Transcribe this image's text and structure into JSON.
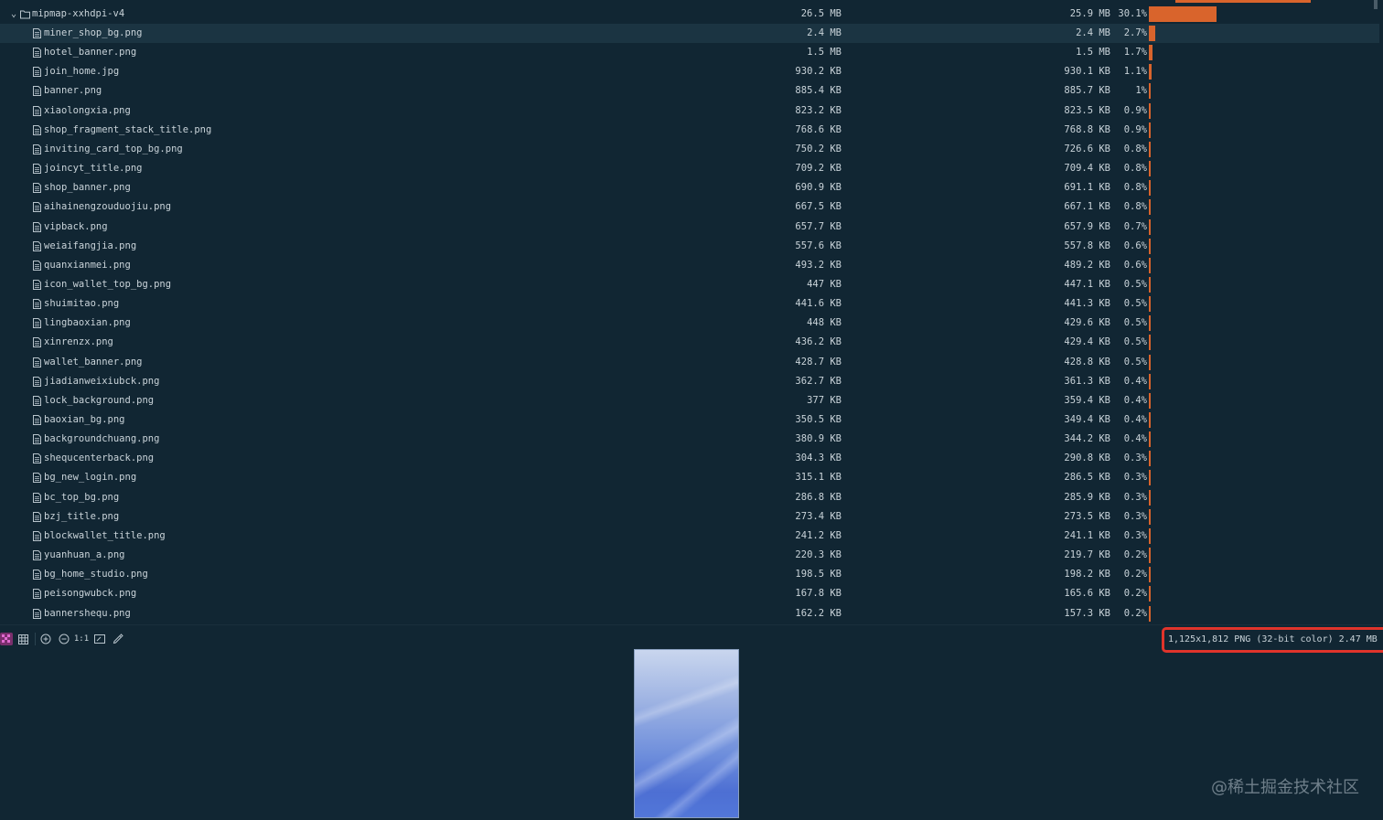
{
  "folder": {
    "name": "mipmap-xxhdpi-v4",
    "size": "26.5 MB",
    "size2": "25.9 MB",
    "percent": "30.1%",
    "bar_fraction": 0.301,
    "expanded": true
  },
  "files": [
    {
      "name": "miner_shop_bg.png",
      "size": "2.4 MB",
      "size2": "2.4 MB",
      "percent": "2.7%",
      "fraction": 0.027,
      "selected": true
    },
    {
      "name": "hotel_banner.png",
      "size": "1.5 MB",
      "size2": "1.5 MB",
      "percent": "1.7%",
      "fraction": 0.017
    },
    {
      "name": "join_home.jpg",
      "size": "930.2 KB",
      "size2": "930.1 KB",
      "percent": "1.1%",
      "fraction": 0.011
    },
    {
      "name": "banner.png",
      "size": "885.4 KB",
      "size2": "885.7 KB",
      "percent": "1%",
      "fraction": 0.01
    },
    {
      "name": "xiaolongxia.png",
      "size": "823.2 KB",
      "size2": "823.5 KB",
      "percent": "0.9%",
      "fraction": 0.009
    },
    {
      "name": "shop_fragment_stack_title.png",
      "size": "768.6 KB",
      "size2": "768.8 KB",
      "percent": "0.9%",
      "fraction": 0.009
    },
    {
      "name": "inviting_card_top_bg.png",
      "size": "750.2 KB",
      "size2": "726.6 KB",
      "percent": "0.8%",
      "fraction": 0.008
    },
    {
      "name": "joincyt_title.png",
      "size": "709.2 KB",
      "size2": "709.4 KB",
      "percent": "0.8%",
      "fraction": 0.008
    },
    {
      "name": "shop_banner.png",
      "size": "690.9 KB",
      "size2": "691.1 KB",
      "percent": "0.8%",
      "fraction": 0.008
    },
    {
      "name": "aihainengzouduojiu.png",
      "size": "667.5 KB",
      "size2": "667.1 KB",
      "percent": "0.8%",
      "fraction": 0.008
    },
    {
      "name": "vipback.png",
      "size": "657.7 KB",
      "size2": "657.9 KB",
      "percent": "0.7%",
      "fraction": 0.007
    },
    {
      "name": "weiaifangjia.png",
      "size": "557.6 KB",
      "size2": "557.8 KB",
      "percent": "0.6%",
      "fraction": 0.006
    },
    {
      "name": "quanxianmei.png",
      "size": "493.2 KB",
      "size2": "489.2 KB",
      "percent": "0.6%",
      "fraction": 0.006
    },
    {
      "name": "icon_wallet_top_bg.png",
      "size": "447 KB",
      "size2": "447.1 KB",
      "percent": "0.5%",
      "fraction": 0.005
    },
    {
      "name": "shuimitao.png",
      "size": "441.6 KB",
      "size2": "441.3 KB",
      "percent": "0.5%",
      "fraction": 0.005
    },
    {
      "name": "lingbaoxian.png",
      "size": "448 KB",
      "size2": "429.6 KB",
      "percent": "0.5%",
      "fraction": 0.005
    },
    {
      "name": "xinrenzx.png",
      "size": "436.2 KB",
      "size2": "429.4 KB",
      "percent": "0.5%",
      "fraction": 0.005
    },
    {
      "name": "wallet_banner.png",
      "size": "428.7 KB",
      "size2": "428.8 KB",
      "percent": "0.5%",
      "fraction": 0.005
    },
    {
      "name": "jiadianweixiubck.png",
      "size": "362.7 KB",
      "size2": "361.3 KB",
      "percent": "0.4%",
      "fraction": 0.004
    },
    {
      "name": "lock_background.png",
      "size": "377 KB",
      "size2": "359.4 KB",
      "percent": "0.4%",
      "fraction": 0.004
    },
    {
      "name": "baoxian_bg.png",
      "size": "350.5 KB",
      "size2": "349.4 KB",
      "percent": "0.4%",
      "fraction": 0.004
    },
    {
      "name": "backgroundchuang.png",
      "size": "380.9 KB",
      "size2": "344.2 KB",
      "percent": "0.4%",
      "fraction": 0.004
    },
    {
      "name": "shequcenterback.png",
      "size": "304.3 KB",
      "size2": "290.8 KB",
      "percent": "0.3%",
      "fraction": 0.003
    },
    {
      "name": "bg_new_login.png",
      "size": "315.1 KB",
      "size2": "286.5 KB",
      "percent": "0.3%",
      "fraction": 0.003
    },
    {
      "name": "bc_top_bg.png",
      "size": "286.8 KB",
      "size2": "285.9 KB",
      "percent": "0.3%",
      "fraction": 0.003
    },
    {
      "name": "bzj_title.png",
      "size": "273.4 KB",
      "size2": "273.5 KB",
      "percent": "0.3%",
      "fraction": 0.003
    },
    {
      "name": "blockwallet_title.png",
      "size": "241.2 KB",
      "size2": "241.1 KB",
      "percent": "0.3%",
      "fraction": 0.003
    },
    {
      "name": "yuanhuan_a.png",
      "size": "220.3 KB",
      "size2": "219.7 KB",
      "percent": "0.2%",
      "fraction": 0.002
    },
    {
      "name": "bg_home_studio.png",
      "size": "198.5 KB",
      "size2": "198.2 KB",
      "percent": "0.2%",
      "fraction": 0.002
    },
    {
      "name": "peisongwubck.png",
      "size": "167.8 KB",
      "size2": "165.6 KB",
      "percent": "0.2%",
      "fraction": 0.002
    },
    {
      "name": "bannershequ.png",
      "size": "162.2 KB",
      "size2": "157.3 KB",
      "percent": "0.2%",
      "fraction": 0.002
    }
  ],
  "toolbar": {
    "items": [
      "checkerboard-icon",
      "grid-icon",
      "zoom-in-icon",
      "zoom-out-icon",
      "actual-size-label",
      "fit-window-icon",
      "color-picker-icon"
    ],
    "actual_size_label": "1:1"
  },
  "image_info": "1,125x1,812 PNG (32-bit color) 2.47 MB",
  "watermark": "@稀土掘金技术社区",
  "colors": {
    "background": "#112633",
    "bar": "#d9642c",
    "selected_row": "#1b3442",
    "highlight_border": "#e0342b"
  }
}
